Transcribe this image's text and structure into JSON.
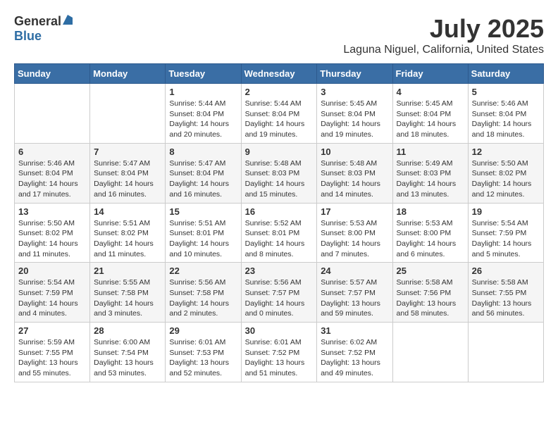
{
  "header": {
    "logo_general": "General",
    "logo_blue": "Blue",
    "title": "July 2025",
    "location": "Laguna Niguel, California, United States"
  },
  "calendar": {
    "weekdays": [
      "Sunday",
      "Monday",
      "Tuesday",
      "Wednesday",
      "Thursday",
      "Friday",
      "Saturday"
    ],
    "weeks": [
      [
        {
          "day": "",
          "sunrise": "",
          "sunset": "",
          "daylight": ""
        },
        {
          "day": "",
          "sunrise": "",
          "sunset": "",
          "daylight": ""
        },
        {
          "day": "1",
          "sunrise": "Sunrise: 5:44 AM",
          "sunset": "Sunset: 8:04 PM",
          "daylight": "Daylight: 14 hours and 20 minutes."
        },
        {
          "day": "2",
          "sunrise": "Sunrise: 5:44 AM",
          "sunset": "Sunset: 8:04 PM",
          "daylight": "Daylight: 14 hours and 19 minutes."
        },
        {
          "day": "3",
          "sunrise": "Sunrise: 5:45 AM",
          "sunset": "Sunset: 8:04 PM",
          "daylight": "Daylight: 14 hours and 19 minutes."
        },
        {
          "day": "4",
          "sunrise": "Sunrise: 5:45 AM",
          "sunset": "Sunset: 8:04 PM",
          "daylight": "Daylight: 14 hours and 18 minutes."
        },
        {
          "day": "5",
          "sunrise": "Sunrise: 5:46 AM",
          "sunset": "Sunset: 8:04 PM",
          "daylight": "Daylight: 14 hours and 18 minutes."
        }
      ],
      [
        {
          "day": "6",
          "sunrise": "Sunrise: 5:46 AM",
          "sunset": "Sunset: 8:04 PM",
          "daylight": "Daylight: 14 hours and 17 minutes."
        },
        {
          "day": "7",
          "sunrise": "Sunrise: 5:47 AM",
          "sunset": "Sunset: 8:04 PM",
          "daylight": "Daylight: 14 hours and 16 minutes."
        },
        {
          "day": "8",
          "sunrise": "Sunrise: 5:47 AM",
          "sunset": "Sunset: 8:04 PM",
          "daylight": "Daylight: 14 hours and 16 minutes."
        },
        {
          "day": "9",
          "sunrise": "Sunrise: 5:48 AM",
          "sunset": "Sunset: 8:03 PM",
          "daylight": "Daylight: 14 hours and 15 minutes."
        },
        {
          "day": "10",
          "sunrise": "Sunrise: 5:48 AM",
          "sunset": "Sunset: 8:03 PM",
          "daylight": "Daylight: 14 hours and 14 minutes."
        },
        {
          "day": "11",
          "sunrise": "Sunrise: 5:49 AM",
          "sunset": "Sunset: 8:03 PM",
          "daylight": "Daylight: 14 hours and 13 minutes."
        },
        {
          "day": "12",
          "sunrise": "Sunrise: 5:50 AM",
          "sunset": "Sunset: 8:02 PM",
          "daylight": "Daylight: 14 hours and 12 minutes."
        }
      ],
      [
        {
          "day": "13",
          "sunrise": "Sunrise: 5:50 AM",
          "sunset": "Sunset: 8:02 PM",
          "daylight": "Daylight: 14 hours and 11 minutes."
        },
        {
          "day": "14",
          "sunrise": "Sunrise: 5:51 AM",
          "sunset": "Sunset: 8:02 PM",
          "daylight": "Daylight: 14 hours and 11 minutes."
        },
        {
          "day": "15",
          "sunrise": "Sunrise: 5:51 AM",
          "sunset": "Sunset: 8:01 PM",
          "daylight": "Daylight: 14 hours and 10 minutes."
        },
        {
          "day": "16",
          "sunrise": "Sunrise: 5:52 AM",
          "sunset": "Sunset: 8:01 PM",
          "daylight": "Daylight: 14 hours and 8 minutes."
        },
        {
          "day": "17",
          "sunrise": "Sunrise: 5:53 AM",
          "sunset": "Sunset: 8:00 PM",
          "daylight": "Daylight: 14 hours and 7 minutes."
        },
        {
          "day": "18",
          "sunrise": "Sunrise: 5:53 AM",
          "sunset": "Sunset: 8:00 PM",
          "daylight": "Daylight: 14 hours and 6 minutes."
        },
        {
          "day": "19",
          "sunrise": "Sunrise: 5:54 AM",
          "sunset": "Sunset: 7:59 PM",
          "daylight": "Daylight: 14 hours and 5 minutes."
        }
      ],
      [
        {
          "day": "20",
          "sunrise": "Sunrise: 5:54 AM",
          "sunset": "Sunset: 7:59 PM",
          "daylight": "Daylight: 14 hours and 4 minutes."
        },
        {
          "day": "21",
          "sunrise": "Sunrise: 5:55 AM",
          "sunset": "Sunset: 7:58 PM",
          "daylight": "Daylight: 14 hours and 3 minutes."
        },
        {
          "day": "22",
          "sunrise": "Sunrise: 5:56 AM",
          "sunset": "Sunset: 7:58 PM",
          "daylight": "Daylight: 14 hours and 2 minutes."
        },
        {
          "day": "23",
          "sunrise": "Sunrise: 5:56 AM",
          "sunset": "Sunset: 7:57 PM",
          "daylight": "Daylight: 14 hours and 0 minutes."
        },
        {
          "day": "24",
          "sunrise": "Sunrise: 5:57 AM",
          "sunset": "Sunset: 7:57 PM",
          "daylight": "Daylight: 13 hours and 59 minutes."
        },
        {
          "day": "25",
          "sunrise": "Sunrise: 5:58 AM",
          "sunset": "Sunset: 7:56 PM",
          "daylight": "Daylight: 13 hours and 58 minutes."
        },
        {
          "day": "26",
          "sunrise": "Sunrise: 5:58 AM",
          "sunset": "Sunset: 7:55 PM",
          "daylight": "Daylight: 13 hours and 56 minutes."
        }
      ],
      [
        {
          "day": "27",
          "sunrise": "Sunrise: 5:59 AM",
          "sunset": "Sunset: 7:55 PM",
          "daylight": "Daylight: 13 hours and 55 minutes."
        },
        {
          "day": "28",
          "sunrise": "Sunrise: 6:00 AM",
          "sunset": "Sunset: 7:54 PM",
          "daylight": "Daylight: 13 hours and 53 minutes."
        },
        {
          "day": "29",
          "sunrise": "Sunrise: 6:01 AM",
          "sunset": "Sunset: 7:53 PM",
          "daylight": "Daylight: 13 hours and 52 minutes."
        },
        {
          "day": "30",
          "sunrise": "Sunrise: 6:01 AM",
          "sunset": "Sunset: 7:52 PM",
          "daylight": "Daylight: 13 hours and 51 minutes."
        },
        {
          "day": "31",
          "sunrise": "Sunrise: 6:02 AM",
          "sunset": "Sunset: 7:52 PM",
          "daylight": "Daylight: 13 hours and 49 minutes."
        },
        {
          "day": "",
          "sunrise": "",
          "sunset": "",
          "daylight": ""
        },
        {
          "day": "",
          "sunrise": "",
          "sunset": "",
          "daylight": ""
        }
      ]
    ]
  }
}
